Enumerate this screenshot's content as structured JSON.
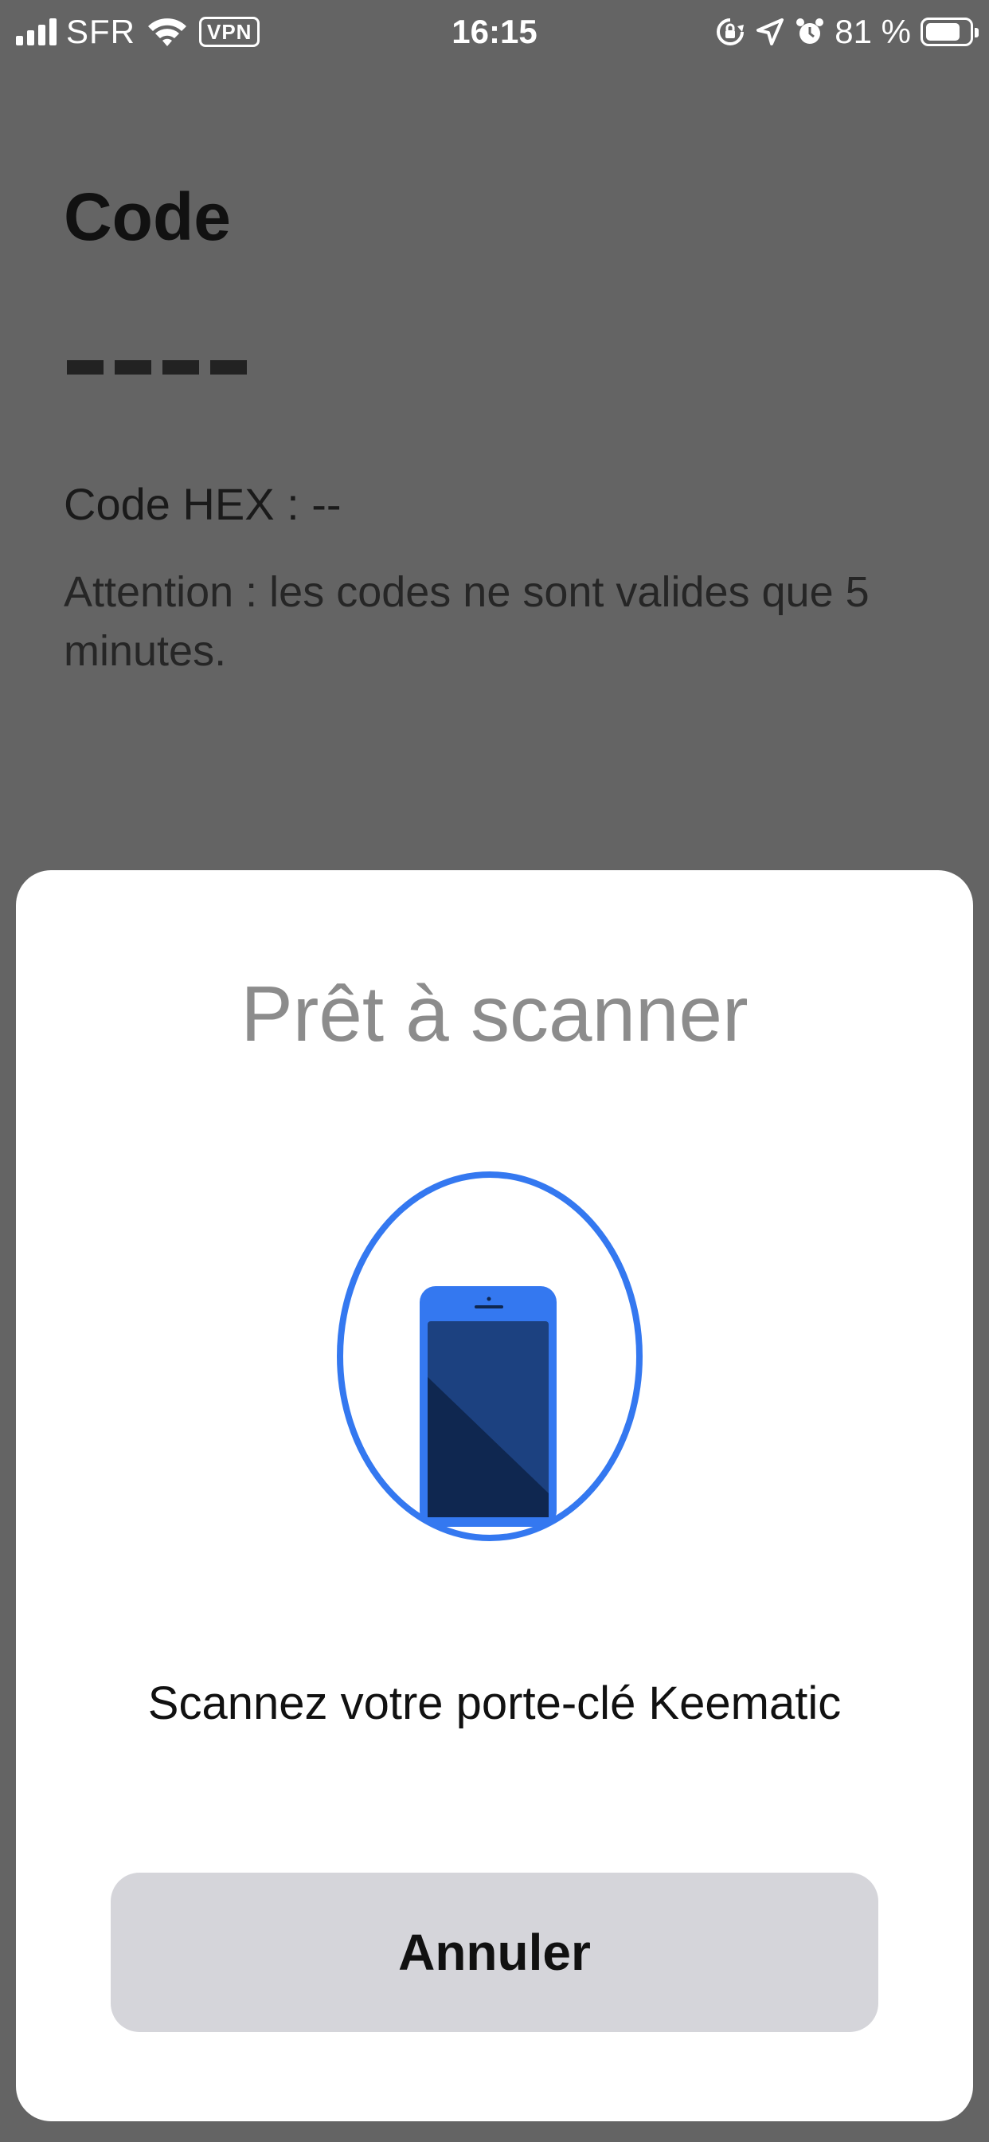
{
  "status_bar": {
    "carrier": "SFR",
    "vpn_label": "VPN",
    "time": "16:15",
    "battery_percent": "81 %",
    "battery_level": 0.81,
    "icons": [
      "signal-icon",
      "wifi-icon",
      "vpn-icon",
      "orientation-lock-icon",
      "location-icon",
      "alarm-icon",
      "battery-icon"
    ]
  },
  "page": {
    "title": "Code",
    "code_hex_label": "Code HEX : --",
    "warning": "Attention : les codes ne sont valides que 5 minutes."
  },
  "scan_sheet": {
    "title": "Prêt à scanner",
    "illustration_icon": "phone-scan-icon",
    "message": "Scannez votre porte-clé Keematic",
    "cancel_label": "Annuler"
  },
  "colors": {
    "overlay": "#646464",
    "sheet_bg": "#ffffff",
    "accent_blue": "#3478f0",
    "phone_screen": "#1c4180",
    "phone_shadow": "#0f2750",
    "button_bg": "#d5d5da",
    "title_gray": "#8c8c8c"
  }
}
